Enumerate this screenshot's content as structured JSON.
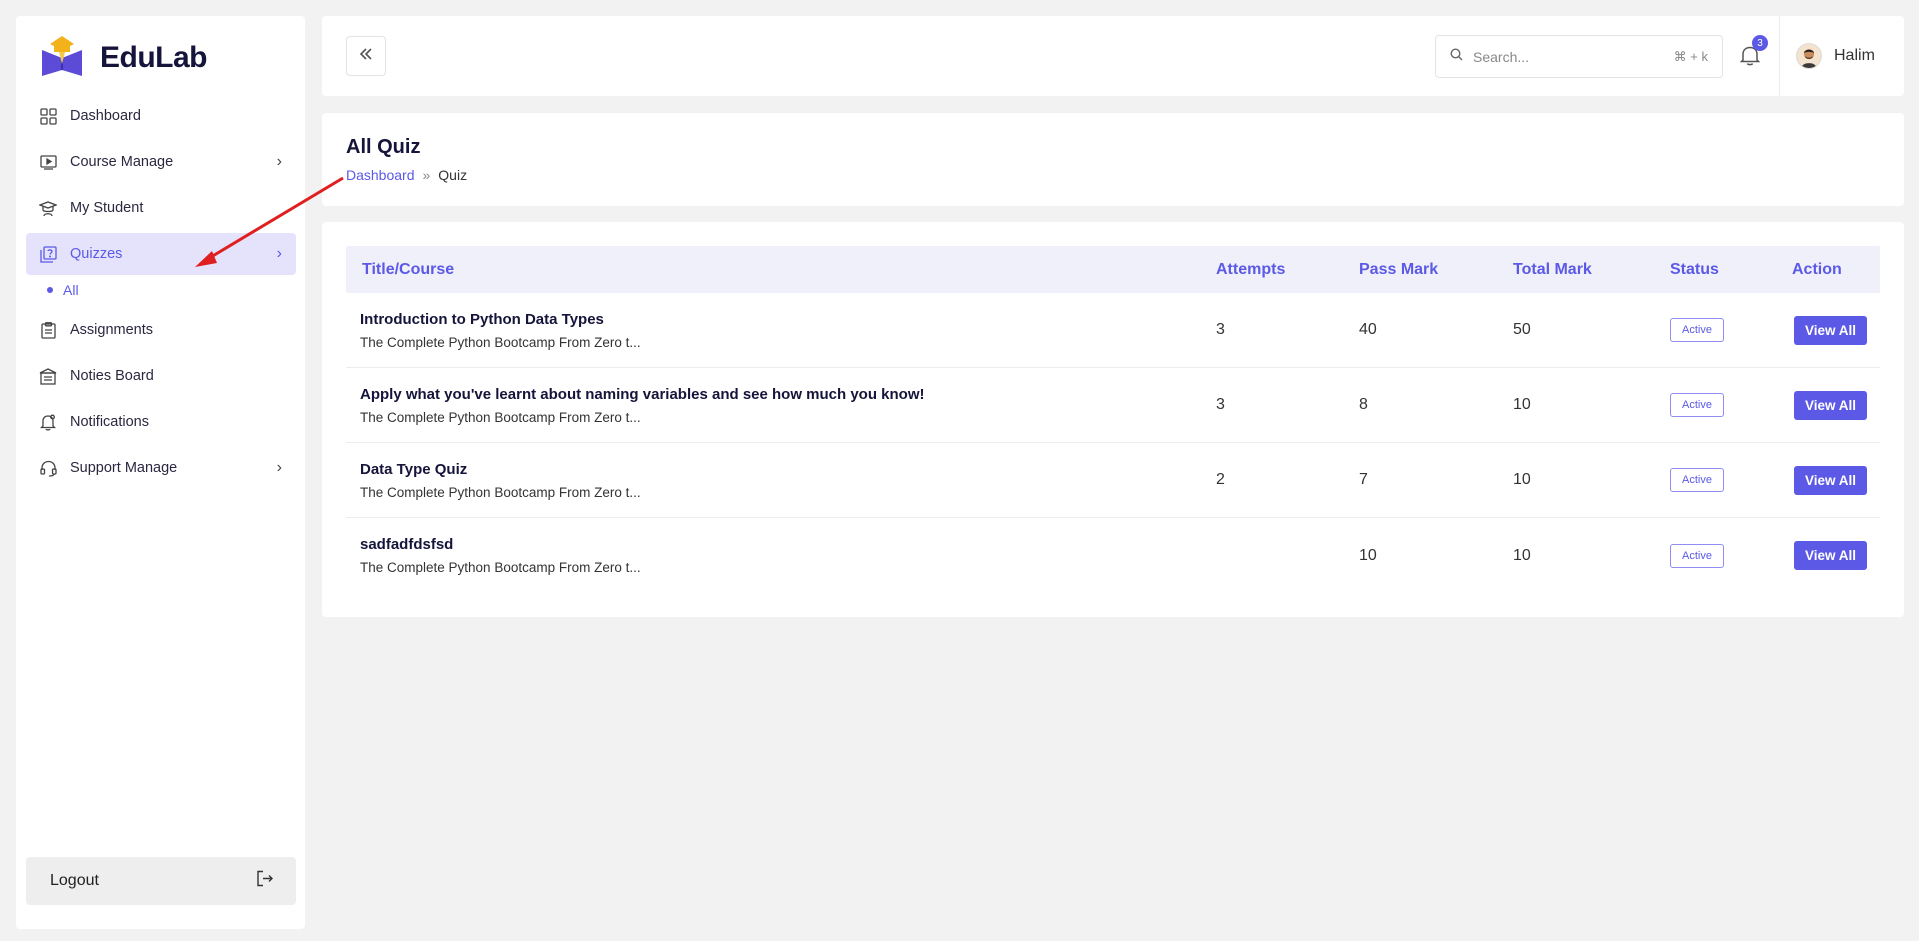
{
  "brand": {
    "name": "EduLab"
  },
  "sidebar": {
    "items": [
      {
        "label": "Dashboard",
        "icon": "grid-icon"
      },
      {
        "label": "Course Manage",
        "icon": "video-icon"
      },
      {
        "label": "My Student",
        "icon": "graduate-icon"
      },
      {
        "label": "Quizzes",
        "icon": "quiz-icon"
      },
      {
        "label": "Assignments",
        "icon": "clipboard-icon"
      },
      {
        "label": "Noties Board",
        "icon": "board-icon"
      },
      {
        "label": "Notifications",
        "icon": "bell-icon"
      },
      {
        "label": "Support Manage",
        "icon": "headset-icon"
      }
    ],
    "subitem": "All",
    "logout": "Logout"
  },
  "topbar": {
    "search_placeholder": "Search...",
    "shortcut": "⌘ + k",
    "notification_count": "3",
    "user_name": "Halim"
  },
  "page": {
    "title": "All Quiz",
    "breadcrumb": {
      "link": "Dashboard",
      "separator": "»",
      "current": "Quiz"
    }
  },
  "table": {
    "headers": {
      "title": "Title/Course",
      "attempts": "Attempts",
      "pass": "Pass Mark",
      "total": "Total Mark",
      "status": "Status",
      "action": "Action"
    },
    "rows": [
      {
        "title": "Introduction to Python Data Types",
        "course": "The Complete Python Bootcamp From Zero t...",
        "attempts": "3",
        "pass": "40",
        "total": "50",
        "status": "Active",
        "action": "View All"
      },
      {
        "title": "Apply what you've learnt about naming variables and see how much you know!",
        "course": "The Complete Python Bootcamp From Zero t...",
        "attempts": "3",
        "pass": "8",
        "total": "10",
        "status": "Active",
        "action": "View All"
      },
      {
        "title": "Data Type Quiz",
        "course": "The Complete Python Bootcamp From Zero t...",
        "attempts": "2",
        "pass": "7",
        "total": "10",
        "status": "Active",
        "action": "View All"
      },
      {
        "title": "sadfadfdsfsd",
        "course": "The Complete Python Bootcamp From Zero t...",
        "attempts": "",
        "pass": "10",
        "total": "10",
        "status": "Active",
        "action": "View All"
      }
    ]
  },
  "colors": {
    "accent": "#5b59e6",
    "annotation_arrow": "#e02020"
  }
}
